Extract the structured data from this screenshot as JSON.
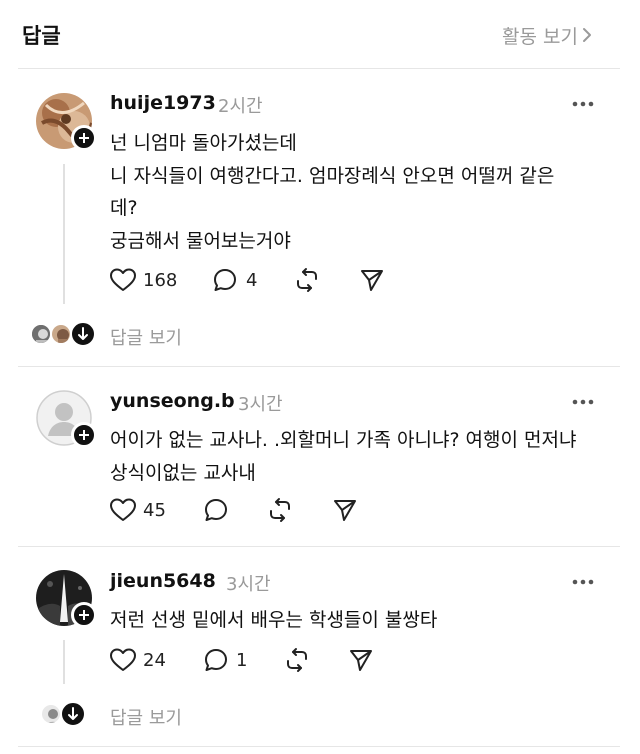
{
  "header": {
    "title": "답글",
    "activity_label": "활동 보기"
  },
  "comments": [
    {
      "username": "huije1973",
      "time": "2시간",
      "lines": [
        "넌 니엄마 돌아가셨는데",
        "니 자식들이 여행간다고. 엄마장례식 안오면 어떨꺼 같은",
        "데?",
        "궁금해서 물어보는거야"
      ],
      "likes": "168",
      "replies": "4",
      "view_replies": "답글 보기"
    },
    {
      "username": "yunseong.b",
      "time": "3시간",
      "lines": [
        "어이가 없는 교사나. .외할머니 가족 아니냐? 여행이 먼저냐",
        "상식이없는 교사내"
      ],
      "likes": "45"
    },
    {
      "username": "jieun5648",
      "time": "3시간",
      "lines": [
        "저런 선생 밑에서 배우는 학생들이 불쌍타"
      ],
      "likes": "24",
      "replies": "1",
      "view_replies": "답글 보기"
    }
  ],
  "icons": {
    "like": "heart-icon",
    "reply": "comment-icon",
    "repost": "repost-icon",
    "share": "send-icon",
    "more": "more-icon"
  }
}
